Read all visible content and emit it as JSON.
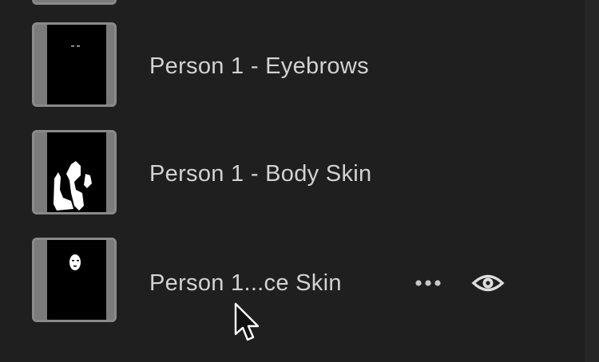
{
  "layers": [
    {
      "name": "Person 1 - Eyebrows"
    },
    {
      "name": "Person 1 - Body Skin"
    },
    {
      "name": "Person 1...ce Skin"
    }
  ],
  "actions": {
    "more_icon": "more-horizontal-icon",
    "visibility_icon": "eye-icon"
  },
  "colors": {
    "panel_bg": "#1f1f1f",
    "text": "#d2d2d2",
    "thumb_border": "#8a8a8a"
  }
}
